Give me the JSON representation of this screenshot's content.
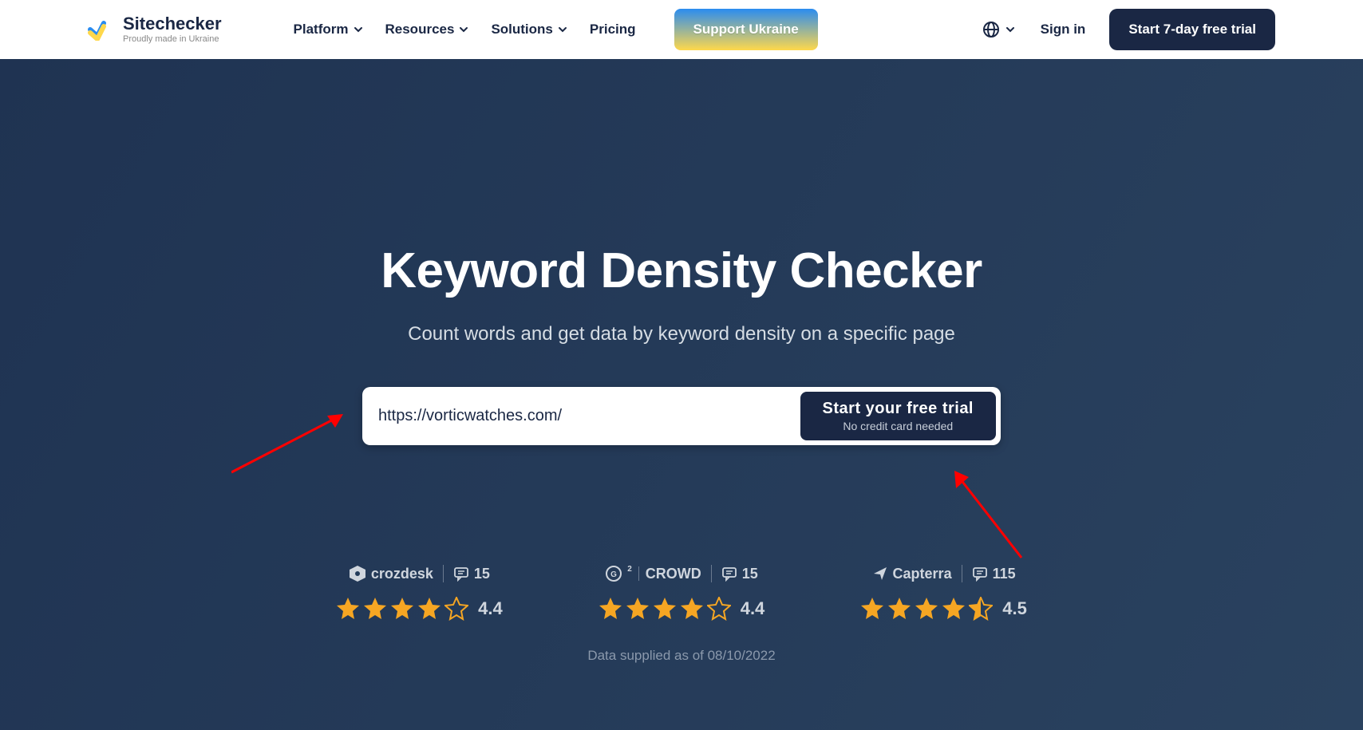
{
  "header": {
    "brand": "Sitechecker",
    "brand_tag": "Proudly made in Ukraine",
    "nav": {
      "platform": "Platform",
      "resources": "Resources",
      "solutions": "Solutions",
      "pricing": "Pricing"
    },
    "support_btn": "Support Ukraine",
    "sign_in": "Sign in",
    "trial_btn": "Start 7-day free trial"
  },
  "hero": {
    "title": "Keyword Density Checker",
    "subtitle": "Count words and get data by keyword density on a specific page",
    "url_value": "https://vorticwatches.com/",
    "cta_main": "Start your free trial",
    "cta_sub": "No credit card needed"
  },
  "reviews": [
    {
      "name": "crozdesk",
      "count": "15",
      "rating": "4.4"
    },
    {
      "name": "CROWD",
      "count": "15",
      "rating": "4.4"
    },
    {
      "name": "Capterra",
      "count": "115",
      "rating": "4.5"
    }
  ],
  "supplied": "Data supplied as of 08/10/2022"
}
